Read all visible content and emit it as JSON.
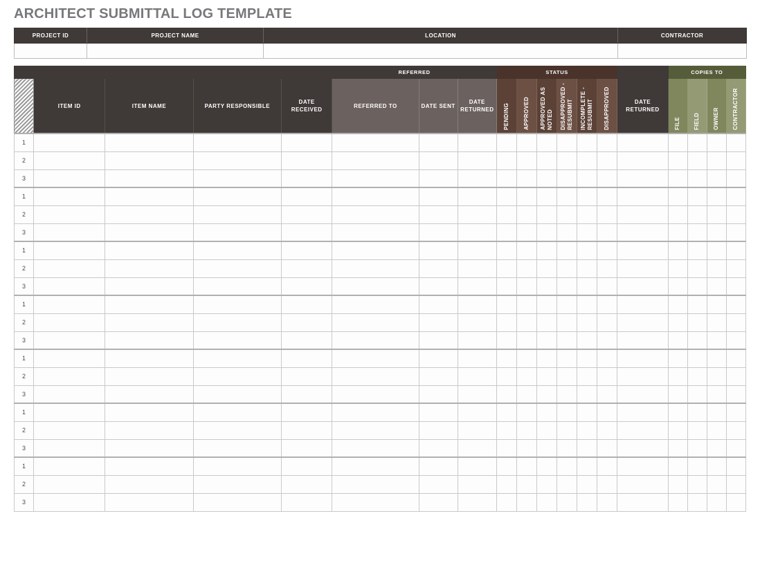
{
  "page": {
    "title": "ARCHITECT SUBMITTAL LOG TEMPLATE"
  },
  "project_info": {
    "headers": [
      "PROJECT ID",
      "PROJECT NAME",
      "LOCATION",
      "CONTRACTOR"
    ],
    "values": [
      "",
      "",
      "",
      ""
    ]
  },
  "log_table": {
    "group_headers": {
      "rownum": "",
      "referred": "REFERRED",
      "status": "STATUS",
      "copies_to": "COPIES TO"
    },
    "columns": {
      "rownum": "",
      "item_id": "ITEM ID",
      "item_name": "ITEM NAME",
      "party_responsible": "PARTY RESPONSIBLE",
      "date_received": "DATE RECEIVED",
      "referred_to": "REFERRED TO",
      "date_sent": "DATE SENT",
      "date_returned_referred": "DATE RETURNED",
      "status_pending": "PENDING",
      "status_approved": "APPROVED",
      "status_approved_as_noted": "APPROVED AS NOTED",
      "status_disapproved_resubmit": "DISAPPROVED - RESUBMIT",
      "status_incomplete_resubmit": "INCOMPLETE - RESUBMIT",
      "status_disapproved": "DISAPPROVED",
      "date_returned": "DATE RETURNED",
      "copies_file": "FILE",
      "copies_field": "FIELD",
      "copies_owner": "OWNER",
      "copies_contractor": "CONTRACTOR"
    },
    "row_numbers": [
      "1",
      "2",
      "3",
      "1",
      "2",
      "3",
      "1",
      "2",
      "3",
      "1",
      "2",
      "3",
      "1",
      "2",
      "3",
      "1",
      "2",
      "3",
      "1",
      "2",
      "3"
    ],
    "group_size": 3,
    "row_count": 21,
    "cell_values": []
  },
  "colors": {
    "title": "#77787a",
    "header_dark": "#3f3937",
    "header_mid": "#6b615e",
    "status_group": "#4a332a",
    "status_col_a": "#5b4136",
    "status_col_b": "#6d5044",
    "copies_group": "#555c39",
    "copies_col_a": "#80875d",
    "copies_col_b": "#949a74",
    "fill_gray": "#eae8e8",
    "fill_pink": "#eee3e0",
    "fill_green": "#eef0e4",
    "grid": "#c9c9c9"
  }
}
